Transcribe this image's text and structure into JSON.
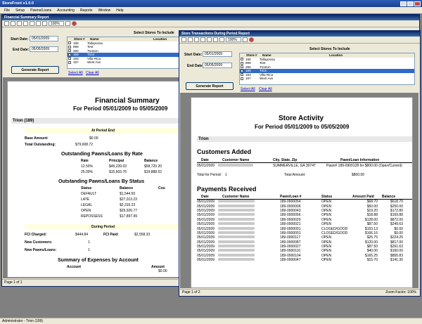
{
  "app": {
    "title": "StoreFront v1.0.0",
    "menu": [
      "File",
      "Setup",
      "Pawns/Loans",
      "Accounting",
      "Reports",
      "Window",
      "Help"
    ],
    "zoom": "100%",
    "status": "Administrator - Trion (189)"
  },
  "fin": {
    "window_title": "Financial Summary Report",
    "start_label": "Start Date:",
    "start_value": "05/01/2009",
    "end_label": "End Date:",
    "end_value": "05/05/2009",
    "stores_header": "Select Stores To Include",
    "cols": [
      "Store #",
      "Name",
      "Location"
    ],
    "stores": [
      {
        "no": "186",
        "name": "Tallapoosa"
      },
      {
        "no": "999",
        "name": "Test"
      },
      {
        "no": "290",
        "name": "Trenton"
      },
      {
        "no": "189",
        "name": "Trion"
      },
      {
        "no": "193",
        "name": "Villa Rica"
      },
      {
        "no": "197",
        "name": "West Ave"
      }
    ],
    "select_all": "Select All",
    "clear_all": "Clear All",
    "generate": "Generate Report",
    "page": "Page 1 of 1",
    "report": {
      "title": "Financial Summary",
      "period": "For Period 05/01/2009 to 05/05/2009",
      "store": "Trion (189)",
      "at_period_end": "At Period End",
      "base_label": "Base Amount:",
      "base_value": "$0.00",
      "total_label": "Total Outstanding:",
      "total_value": "$79,608.72",
      "by_rate_title": "Outstanding Pawns/Loans By Rate",
      "rate_cols": [
        "Rate",
        "Principal",
        "Balance"
      ],
      "rate_rows": [
        [
          "12.50%",
          "$49,239.03",
          "$58,720.20"
        ],
        [
          "25.00%",
          "$15,603.76",
          "$19,888.52"
        ]
      ],
      "by_status_title": "Outstanding Pawns/Loans By Status",
      "status_cols": [
        "Status",
        "Balance",
        "Cou"
      ],
      "status_rows": [
        [
          "DEFAULT",
          "$1,544.50"
        ],
        [
          "LATE",
          "$27,013.23"
        ],
        [
          "LEGAL",
          "$2,316.23"
        ],
        [
          "OPEN",
          "$29,926.77"
        ],
        [
          "REPOSSESS",
          "$17,897.99"
        ]
      ],
      "during": "During Period",
      "fci_charged_label": "FCI Charged:",
      "fci_charged": "$444.84",
      "fci_paid_label": "FCI Paid:",
      "fci_paid": "$2,558.33",
      "new_customers_label": "New Customers:",
      "new_customers": "1",
      "new_pawns_label": "New Pawns/Loans:",
      "new_pawns": "1",
      "expenses_title": "Summary of Expenses by Account",
      "exp_cols": [
        "Account",
        "Amount"
      ],
      "exp_amount": "$0.00"
    }
  },
  "sta": {
    "window_title": "Store Transactions During Period Report",
    "start_label": "Start Date:",
    "start_value": "05/01/2009",
    "end_label": "End Date:",
    "end_value": "05/05/2009",
    "stores_header": "Select Stores To Include",
    "cols": [
      "Store #",
      "Name",
      "Location"
    ],
    "stores": [
      {
        "no": "186",
        "name": "Tallapoosa"
      },
      {
        "no": "999",
        "name": "Test"
      },
      {
        "no": "290",
        "name": "Trenton"
      },
      {
        "no": "189",
        "name": "Trion"
      },
      {
        "no": "193",
        "name": "Villa Rica"
      },
      {
        "no": "197",
        "name": "West Ave"
      }
    ],
    "select_all": "Select All",
    "clear_all": "Clear All",
    "generate": "Generate Report",
    "page": "Page 1 of 2",
    "zoom_label": "Zoom Factor: 100%",
    "report": {
      "title": "Store Activity",
      "period": "For Period 05/01/2009 to 05/05/2009",
      "store": "Trion",
      "customers_title": "Customers Added",
      "cust_cols": [
        "Date",
        "Customer Name",
        "City, State, Zip",
        "Pawn/Loan Information"
      ],
      "cust_row": {
        "date": "05/01/2009",
        "city": "SUMMERVILLE, GA 30747",
        "info": "Pawn# 189-0900128 for $800.00 (Open/Current)"
      },
      "total_period_label": "Total for Period:",
      "total_period": "1",
      "total_amount_label": "Total Amount:",
      "total_amount": "$800.00",
      "payments_title": "Payments Received",
      "pay_cols": [
        "Date",
        "Customer Name",
        "Pawn/Loan #",
        "Status",
        "Amount Paid",
        "Balance"
      ],
      "payments": [
        [
          "05/01/2009",
          "189-0900054",
          "OPEN",
          "$68.70",
          "$618.70"
        ],
        [
          "05/01/2009",
          "189-0900006",
          "OPEN",
          "$50.00",
          "$250.00"
        ],
        [
          "05/01/2009",
          "189-0900043",
          "OPEN",
          "$19.20",
          "$172.80"
        ],
        [
          "05/01/2009",
          "189-0900056",
          "OPEN",
          "$18.88",
          "$169.88"
        ],
        [
          "05/01/2009",
          "189-0900020",
          "OPEN",
          "$128.00",
          "$872.00"
        ],
        [
          "05/01/2009",
          "189-0900021",
          "OPEN",
          "$87.50",
          "$249.63"
        ],
        [
          "05/01/2009",
          "189-0900001",
          "CLOSED/GOOD",
          "$153.13",
          "$0.00"
        ],
        [
          "05/01/2009",
          "189-0900001",
          "CLOSED/GOOD",
          "$166.16",
          "$0.00"
        ],
        [
          "05/01/2009",
          "189-0900117",
          "OPEN",
          "$25.75",
          "$224.25"
        ],
        [
          "05/01/2009",
          "189-0900087",
          "OPEN",
          "$120.00",
          "$817.00"
        ],
        [
          "05/01/2009",
          "189-0900027",
          "OPEN",
          "$87.50",
          "$261.63"
        ],
        [
          "05/01/2009",
          "189-0900110",
          "OPEN",
          "$40.00",
          "$160.00"
        ],
        [
          "05/01/2009",
          "189-0900104",
          "OPEN",
          "$165.25",
          "$855.83"
        ],
        [
          "05/01/2009",
          "189-0900047",
          "OPEN",
          "$15.70",
          "$141.30"
        ]
      ]
    }
  }
}
